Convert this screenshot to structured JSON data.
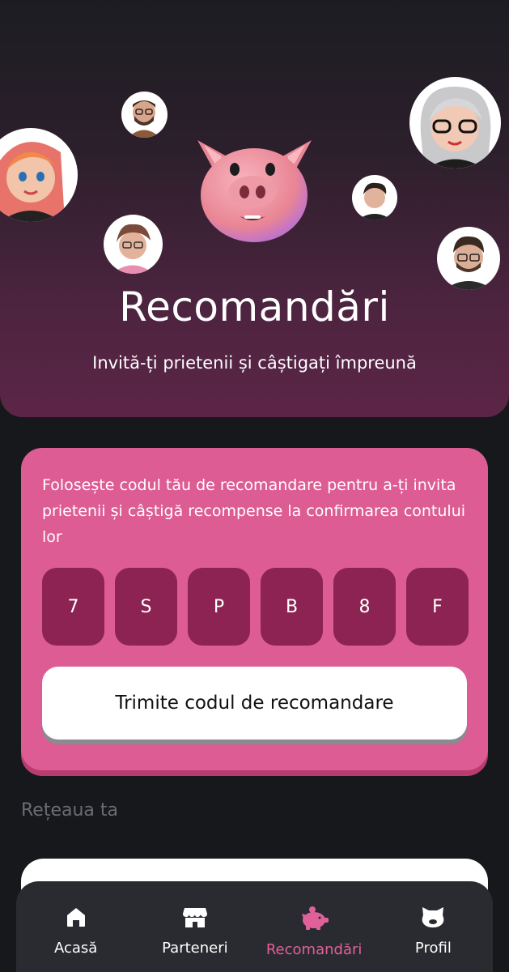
{
  "hero": {
    "title": "Recomandări",
    "subtitle": "Invită-ți prietenii și câștigați împreună"
  },
  "referral": {
    "description": "Folosește codul tău de recomandare pentru a-ți invita prietenii și câștigă recompense la confirmarea contului lor",
    "code": [
      "7",
      "S",
      "P",
      "B",
      "8",
      "F"
    ],
    "send_label": "Trimite codul de recomandare"
  },
  "network": {
    "title": "Rețeaua ta"
  },
  "tabbar": {
    "items": [
      {
        "label": "Acasă",
        "icon": "home-icon"
      },
      {
        "label": "Parteneri",
        "icon": "store-icon"
      },
      {
        "label": "Recomandări",
        "icon": "piggy-icon",
        "active": true
      },
      {
        "label": "Profil",
        "icon": "profile-icon"
      }
    ]
  },
  "colors": {
    "accent": "#dc5c93",
    "code_box": "#8c2352",
    "background": "#17181c",
    "tabbar": "#2a2b30"
  }
}
